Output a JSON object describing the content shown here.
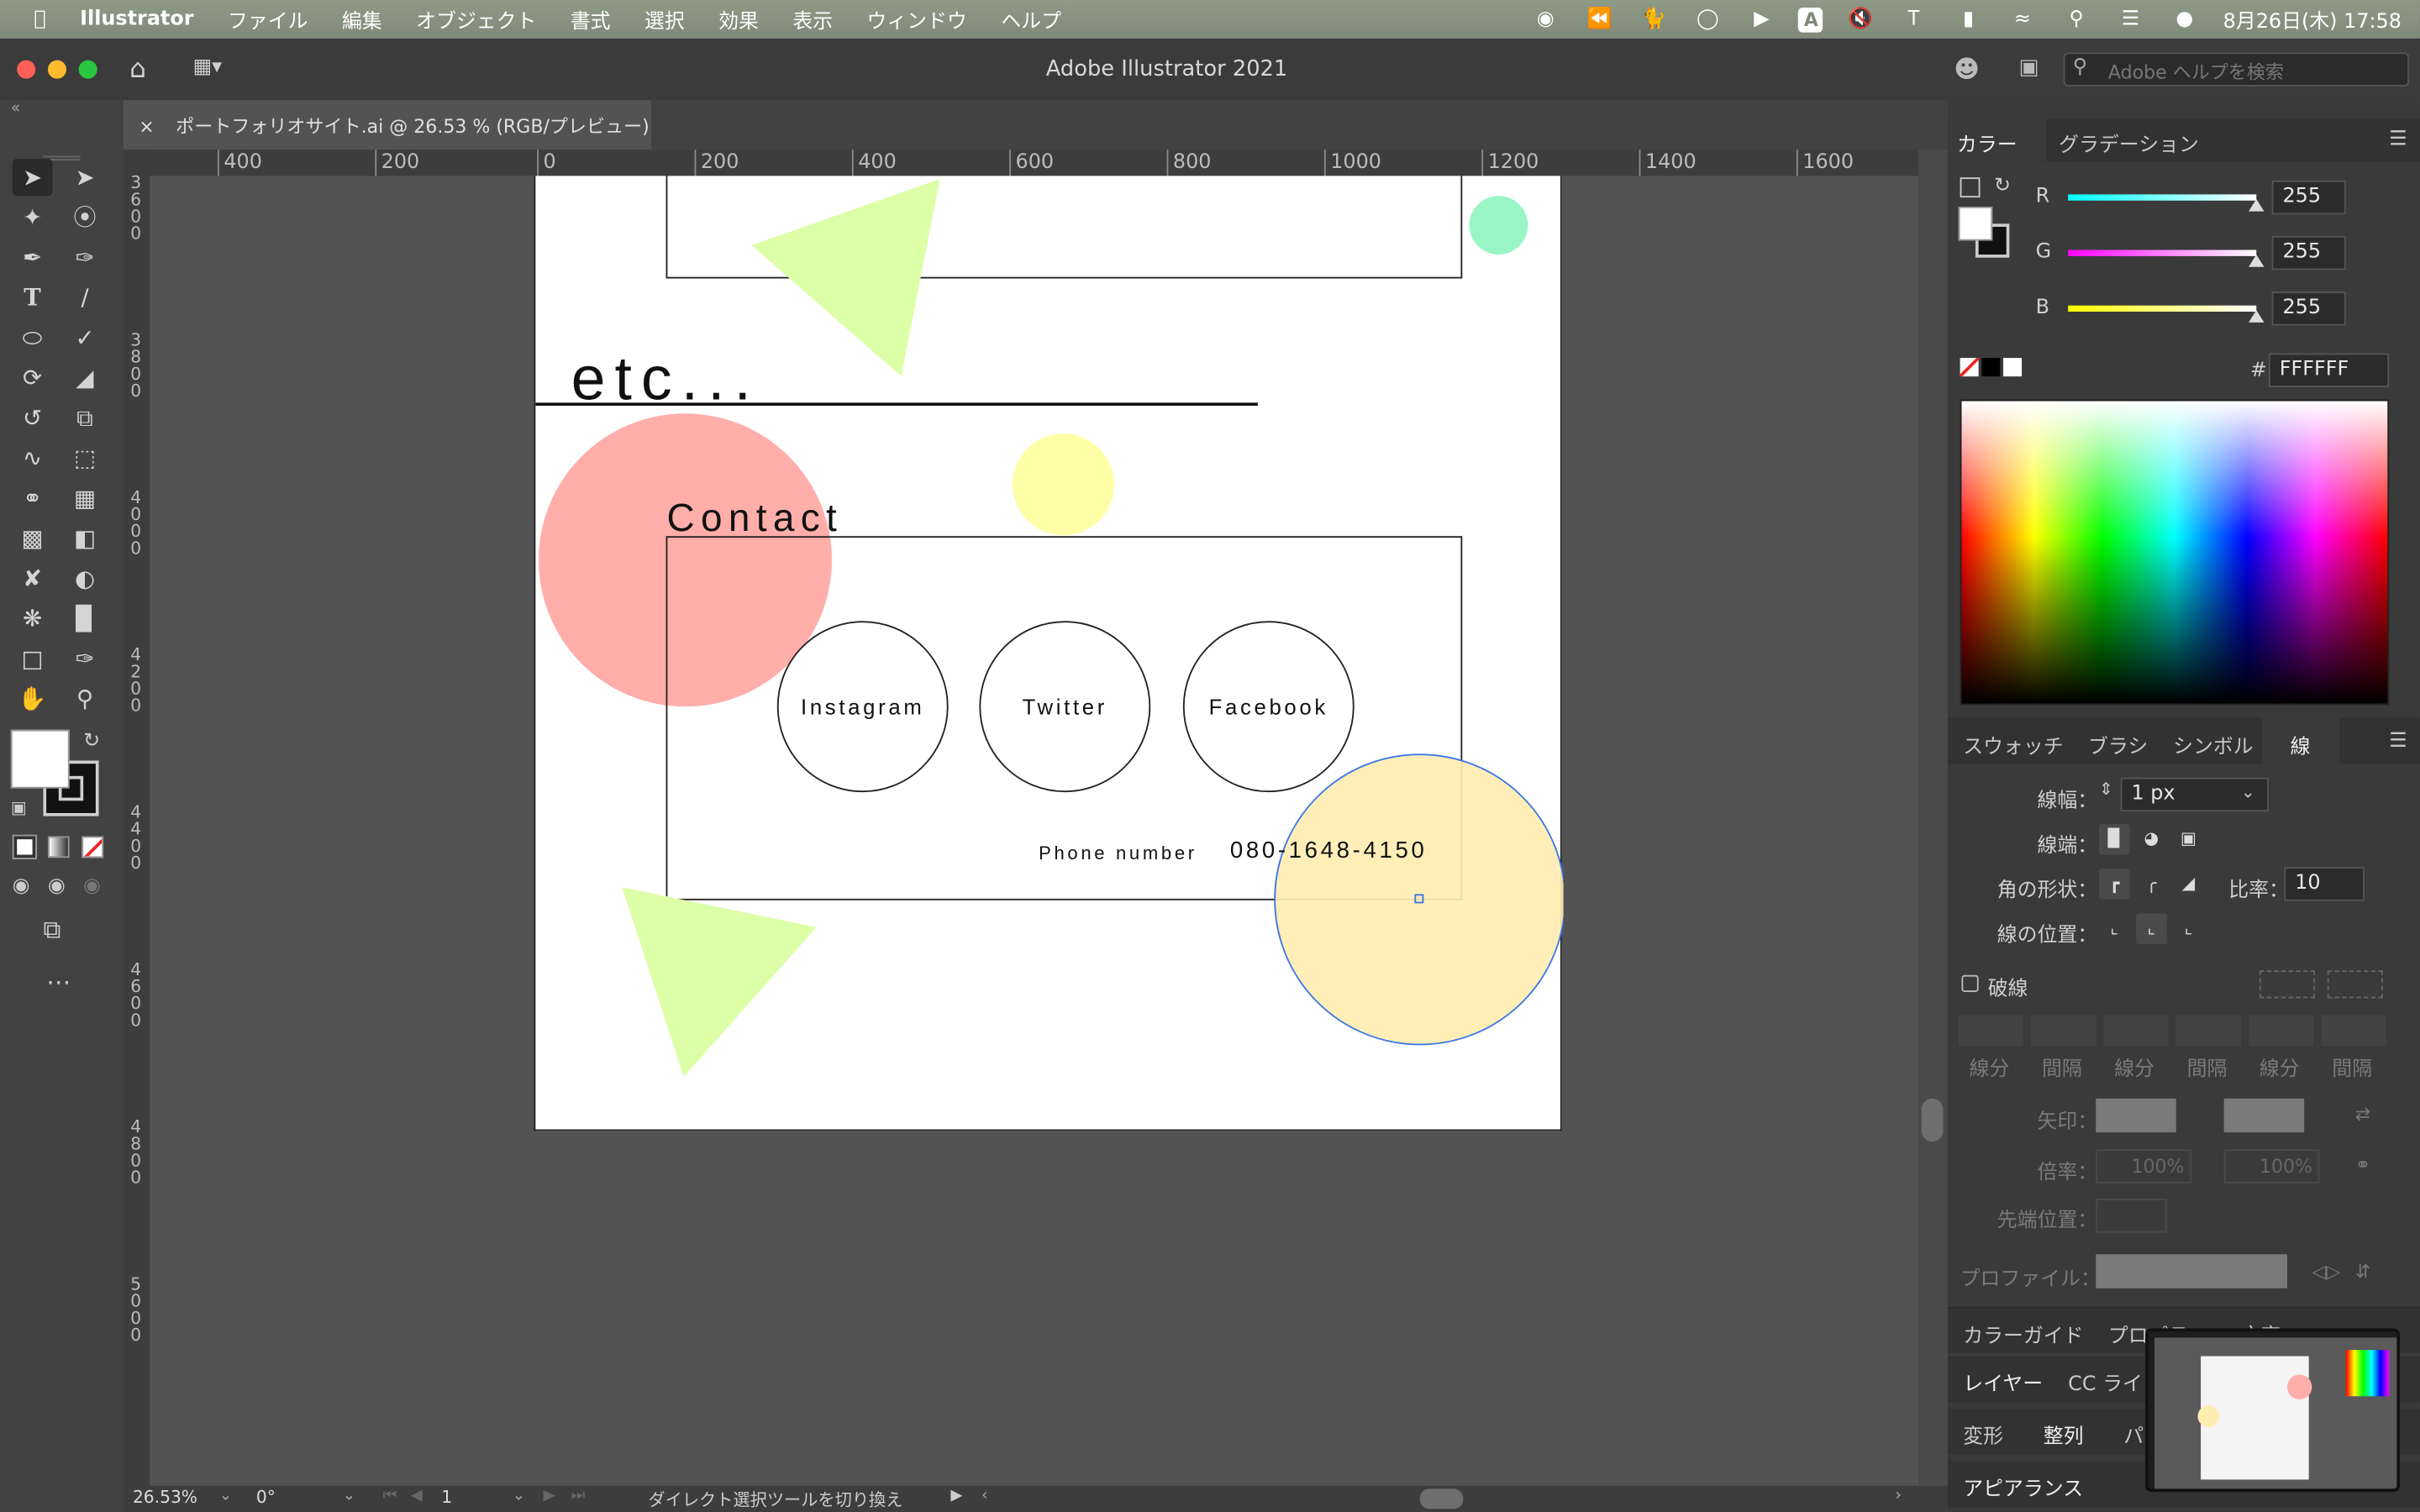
{
  "menubar": {
    "app_name": "Illustrator",
    "items": [
      "ファイル",
      "編集",
      "オブジェクト",
      "書式",
      "選択",
      "効果",
      "表示",
      "ウィンドウ",
      "ヘルプ"
    ],
    "clock": "8月26日(木)  17:58",
    "input_mode": "A"
  },
  "window": {
    "title": "Adobe Illustrator 2021",
    "search_placeholder": "Adobe ヘルプを検索"
  },
  "document_tab": {
    "close": "×",
    "label": "ポートフォリオサイト.ai @ 26.53 % (RGB/プレビュー)"
  },
  "ruler": {
    "horizontal": [
      "400",
      "200",
      "0",
      "200",
      "400",
      "600",
      "800",
      "1000",
      "1200",
      "1400",
      "1600"
    ],
    "vertical": [
      "3600",
      "3800",
      "4000",
      "4200",
      "4400",
      "4600",
      "4800",
      "5000"
    ]
  },
  "artboard": {
    "heading_etc": "etc...",
    "heading_contact": "Contact",
    "social_buttons": [
      "Instagram",
      "Twitter",
      "Facebook"
    ],
    "phone_label": "Phone number",
    "phone_value": "080-1648-4150"
  },
  "colors": {
    "pink_circle": "#ffaeaa",
    "yellow_circle": "#ffffa8",
    "orange_circle": "#ffedb2",
    "mint_circle": "#9af5c5",
    "green_triangle": "#ddffa8",
    "selection_blue": "#3b78e7"
  },
  "color_panel": {
    "tab_color": "カラー",
    "tab_gradient": "グラデーション",
    "r_label": "R",
    "r_value": "255",
    "g_label": "G",
    "g_value": "255",
    "b_label": "B",
    "b_value": "255",
    "hex_label": "#",
    "hex_value": "FFFFFF"
  },
  "stroke_panel": {
    "tabs": [
      "スウォッチ",
      "ブラシ",
      "シンボル",
      "線"
    ],
    "width_label": "線幅：",
    "width_value": "1 px",
    "cap_label": "線端：",
    "corner_label": "角の形状：",
    "ratio_label": "比率：",
    "ratio_value": "10",
    "align_label": "線の位置：",
    "dashed_label": "破線",
    "dash_labels": [
      "線分",
      "間隔",
      "線分",
      "間隔",
      "線分",
      "間隔"
    ],
    "arrow_label": "矢印：",
    "scale_label": "倍率：",
    "scale_values": [
      "100%",
      "100%"
    ],
    "tip_label": "先端位置：",
    "profile_label": "プロファイル："
  },
  "bottom_panels": {
    "row1": [
      "カラーガイド",
      "プロパティ",
      "文字"
    ],
    "row2": [
      "レイヤー",
      "CC ライブラリ"
    ],
    "row3": [
      "変形",
      "整列",
      "パス"
    ],
    "row4": [
      "アピアランス"
    ]
  },
  "status": {
    "zoom": "26.53%",
    "rotation": "0°",
    "artboard_num": "1",
    "message": "ダイレクト選択ツールを切り換え"
  }
}
